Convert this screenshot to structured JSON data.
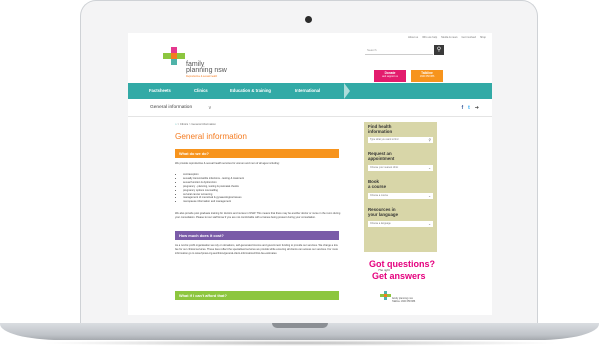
{
  "top_links": [
    "About us",
    "Who we help",
    "Media & news",
    "Get involved",
    "Shop"
  ],
  "logo": {
    "line1": "family",
    "line2": "planning nsw",
    "tagline": "Reproductive & sexual health"
  },
  "search": {
    "placeholder": "Search",
    "button_icon": "search-icon"
  },
  "cta": {
    "donate": {
      "label": "Donate",
      "sub": "and support us"
    },
    "helpline": {
      "label": "Talkline",
      "sub": "1300 658 886"
    }
  },
  "nav": [
    "Factsheets",
    "Clinics",
    "Education & training",
    "International"
  ],
  "subbar": {
    "title": "General information",
    "chevron": "∨",
    "social": [
      "f",
      "t",
      "➔"
    ]
  },
  "breadcrumb": {
    "home_icon": "⌂",
    "sep": ">",
    "items": [
      "Clinics",
      "General information"
    ]
  },
  "page": {
    "title": "General information",
    "section1": "What do we do?",
    "intro": "We provide reproductive & sexual health services for women and men of all ages including:",
    "services": [
      "contraception",
      "sexually transmissible infections - testing & treatment",
      "sexual function & dysfunction",
      "pregnancy - planning, testing & postnatal checks",
      "pregnancy options counselling",
      "cervical cancer screening",
      "management of menstrual & gynaecological issues",
      "menopause information and management"
    ],
    "training_para": "We also provide post graduate training for doctors and nurses in NSW. This means that there may be another doctor or nurse in the room during your consultation. Please let our staff know if you are not comfortable with a trainee being present during your consultation.",
    "section2": "How much does it cost?",
    "cost_para": "As a not-for-profit organisation we rely on donations, self-generated income and government funding to provide our services. We charge a low fee for our clinical services. These fees reflect the specialised services we provide while ensuring all clients can access our services. For more information go to www.fpnsw.org.au/clinics/general-client-information/clinic-fee-estimates",
    "section3": "What if I can't afford that?"
  },
  "sidebar": {
    "find": {
      "title_1": "Find health",
      "title_2": "information",
      "placeholder": "Type what you want to find"
    },
    "appointment": {
      "title_1": "Request an",
      "title_2": "appointment",
      "placeholder": "Choose your nearest clinic"
    },
    "course": {
      "title_1": "Book",
      "title_2": "a course",
      "placeholder": "Choose a course"
    },
    "language": {
      "title_1": "Resources in",
      "title_2": "your language",
      "placeholder": "Choose a language"
    }
  },
  "promo": {
    "line1": "Got questions?",
    "line2": "Get answers",
    "ask": "The right",
    "brand": "family planning nsw",
    "sub": "Talkline 1300 658 886"
  },
  "colors": {
    "teal": "#32aaa6",
    "orange": "#f47b20",
    "pink": "#e5007e",
    "purple": "#7a5ba8",
    "green": "#8dc63f"
  }
}
